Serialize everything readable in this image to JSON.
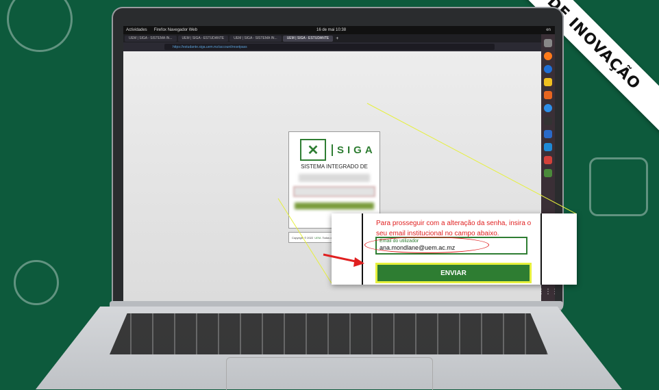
{
  "ribbon": {
    "text": "DE INOVAÇÃO"
  },
  "os_bar": {
    "activities": "Actividades",
    "app": "Firefox Navegador Web",
    "clock": "16 de mai 10:38",
    "tray": "en"
  },
  "browser": {
    "tabs": [
      {
        "label": "UEM | SIGA - SISTEMA IN..."
      },
      {
        "label": "UEM | SIGA - ESTUDANTE"
      },
      {
        "label": "UEM | SIGA - SISTEMA IN..."
      },
      {
        "label": "UEM | SIGA - ESTUDANTE"
      }
    ],
    "url": "https://estudante.siga.uem.mz/account/resetpass"
  },
  "login_card": {
    "logo_text": "SIGA",
    "subtitle": "SISTEMA INTEGRADO DE",
    "enter_link": "Entrar na conta"
  },
  "footer": {
    "copyright": "Copyright © 2022",
    "link": "UEM",
    "rest": "- Todos os Direitos Reservados"
  },
  "zoom": {
    "message": "Para prosseguir com a alteração da senha, insira o seu email institucional no campo abaixo.",
    "email_label": "Email do utilizador",
    "email_value": "ana.mondlane@uem.ac.mz",
    "send_label": "ENVIAR"
  },
  "colors": {
    "background": "#0d5a3c",
    "brand_green": "#2e7d32",
    "highlight_yellow": "#e6f03c",
    "alert_red": "#e02020"
  }
}
